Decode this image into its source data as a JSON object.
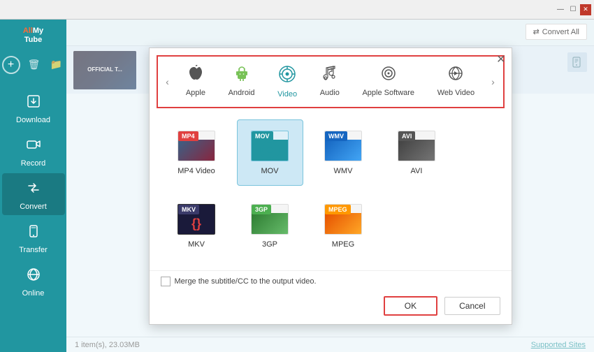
{
  "app": {
    "name": "AllMyTube",
    "name_all": "All",
    "name_my": "My",
    "name_tube": "Tube"
  },
  "titlebar": {
    "icons": [
      "⊟",
      "🔲",
      "×"
    ]
  },
  "sidebar": {
    "items": [
      {
        "id": "download",
        "label": "Download",
        "icon": "⬇"
      },
      {
        "id": "record",
        "label": "Record",
        "icon": "🎥"
      },
      {
        "id": "convert",
        "label": "Convert",
        "icon": "🔄"
      },
      {
        "id": "transfer",
        "label": "Transfer",
        "icon": "📱"
      },
      {
        "id": "online",
        "label": "Online",
        "icon": "🌐"
      }
    ]
  },
  "toolbar": {
    "convert_all_label": "Convert All"
  },
  "modal": {
    "categories": [
      {
        "id": "apple",
        "label": "Apple",
        "active": false
      },
      {
        "id": "android",
        "label": "Android",
        "active": false
      },
      {
        "id": "video",
        "label": "Video",
        "active": true
      },
      {
        "id": "audio",
        "label": "Audio",
        "active": false
      },
      {
        "id": "apple_software",
        "label": "Apple Software",
        "active": false
      },
      {
        "id": "web_video",
        "label": "Web Video",
        "active": false
      }
    ],
    "formats": [
      {
        "id": "mp4",
        "label": "MP4 Video",
        "badge": "MP4",
        "selected": false
      },
      {
        "id": "mov",
        "label": "MOV",
        "badge": "MOV",
        "selected": true
      },
      {
        "id": "wmv",
        "label": "WMV",
        "badge": "WMV",
        "selected": false
      },
      {
        "id": "avi",
        "label": "AVI",
        "badge": "AVI",
        "selected": false
      },
      {
        "id": "mkv",
        "label": "MKV",
        "badge": "MKV",
        "selected": false
      },
      {
        "id": "3gp",
        "label": "3GP",
        "badge": "3GP",
        "selected": false
      },
      {
        "id": "mpeg",
        "label": "MPEG",
        "badge": "MPEG",
        "selected": false
      }
    ],
    "merge_label": "Merge the subtitle/CC to the output video.",
    "ok_label": "OK",
    "cancel_label": "Cancel"
  },
  "statusbar": {
    "item_count": "1 item(s), 23.03MB",
    "supported_sites": "Supported Sites"
  }
}
